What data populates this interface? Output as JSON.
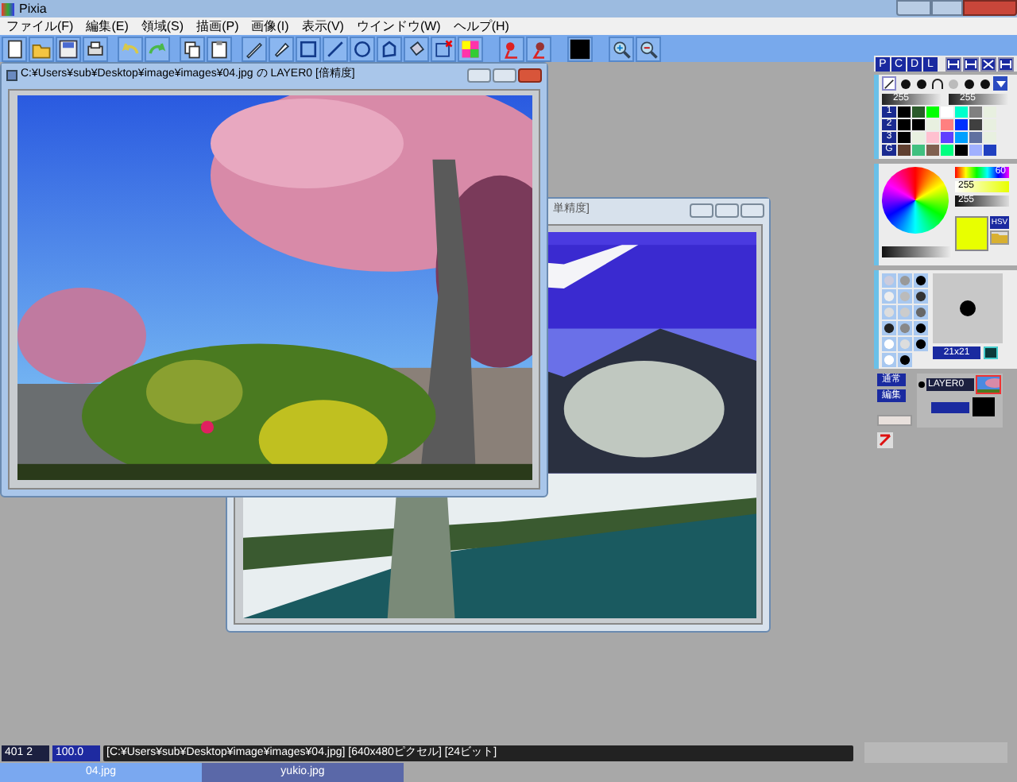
{
  "app": {
    "title": "Pixia"
  },
  "menu": [
    {
      "label": "ファイル(F)"
    },
    {
      "label": "編集(E)"
    },
    {
      "label": "領域(S)"
    },
    {
      "label": "描画(P)"
    },
    {
      "label": "画像(I)"
    },
    {
      "label": "表示(V)"
    },
    {
      "label": "ウインドウ(W)"
    },
    {
      "label": "ヘルプ(H)"
    }
  ],
  "windows": [
    {
      "title": "単精度]",
      "active": false
    },
    {
      "title": "C:¥Users¥sub¥Desktop¥image¥images¥04.jpg の LAYER0 [倍精度]",
      "active": true
    }
  ],
  "palette": {
    "tabs": [
      {
        "label": "P"
      },
      {
        "label": "C"
      },
      {
        "label": "D"
      },
      {
        "label": "L"
      }
    ],
    "levels": [
      "255",
      "255"
    ],
    "row_labels": [
      "1",
      "2",
      "3",
      "G"
    ],
    "swatches": [
      {
        "color": "#000000"
      },
      {
        "color": "#2a5a2a"
      },
      {
        "color": "#00ff00"
      },
      {
        "color": "#ffffff"
      },
      {
        "color": "#00ffcc"
      },
      {
        "color": "#808080"
      },
      {
        "color": "#e8f0e0"
      },
      {
        "color": "#000000"
      },
      {
        "color": "#000000"
      },
      {
        "color": "#e8f0e0"
      },
      {
        "color": "#ff8080"
      },
      {
        "color": "#0030ff"
      },
      {
        "color": "#404040"
      },
      {
        "color": "#e8f0e0"
      },
      {
        "color": "#000000"
      },
      {
        "color": "#e8f0e0"
      },
      {
        "color": "#ffc0d0"
      },
      {
        "color": "#6040ff"
      },
      {
        "color": "#00a0ff"
      },
      {
        "color": "#6070a0"
      },
      {
        "color": "#e8f0e0"
      },
      {
        "color": "#604030"
      },
      {
        "color": "#40c080"
      },
      {
        "color": "#806050"
      },
      {
        "color": "#00ff80"
      },
      {
        "color": "#000000"
      },
      {
        "color": "#a0b0ff"
      },
      {
        "color": "#2040c0"
      }
    ]
  },
  "color_panel": {
    "hue": "60",
    "saturation": "255",
    "value": "255",
    "mode": "HSV",
    "current": {
      "color": "#e8ff00"
    }
  },
  "brush_panel": {
    "size": "21x21"
  },
  "layer_panel": {
    "blend": "通常",
    "edit": "編集",
    "layer": "LAYER0"
  },
  "status_bar": {
    "coords": "401 2",
    "zoom": "100.0",
    "info": "[C:¥Users¥sub¥Desktop¥image¥images¥04.jpg] [640x480ピクセル] [24ビット]"
  },
  "doc_tabs": [
    {
      "label": "04.jpg",
      "selected": true
    },
    {
      "label": "yukio.jpg",
      "selected": false
    }
  ]
}
